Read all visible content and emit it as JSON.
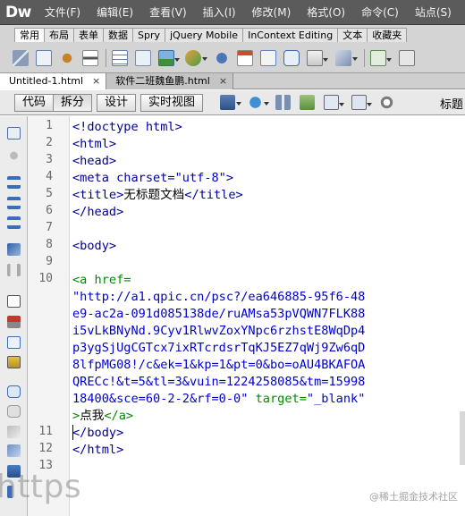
{
  "app": {
    "logo": "Dw"
  },
  "menu": [
    "文件(F)",
    "编辑(E)",
    "查看(V)",
    "插入(I)",
    "修改(M)",
    "格式(O)",
    "命令(C)",
    "站点(S)",
    "窗"
  ],
  "insert_tabs": [
    "常用",
    "布局",
    "表单",
    "数据",
    "Spry",
    "jQuery Mobile",
    "InContext Editing",
    "文本",
    "收藏夹"
  ],
  "insert_active_tab": "常用",
  "doc_tabs": [
    {
      "label": "Untitled-1.html",
      "close": "×",
      "active": true
    },
    {
      "label": "软件二班魏鱼鹏.html",
      "close": "×",
      "active": false
    }
  ],
  "view_buttons": [
    "代码",
    "拆分",
    "设计",
    "实时视图"
  ],
  "view_active": "拆分",
  "title_label": "标题",
  "line_numbers": [
    "1",
    "2",
    "3",
    "4",
    "5",
    "6",
    "7",
    "8",
    "9",
    "10",
    "11",
    "12",
    "13"
  ],
  "code": {
    "l1": "<!doctype html>",
    "l2": "<html>",
    "l3": "<head>",
    "l4a": "<meta charset=",
    "l4b": "\"utf-8\"",
    "l4c": ">",
    "l5a": "<title>",
    "l5b": "无标题文档",
    "l5c": "</title>",
    "l6": "</head>",
    "l8": "<body>",
    "l10a": "<a href=",
    "url": [
      "\"http://a1.qpic.cn/psc?/ea646885-95f6-48",
      "e9-ac2a-091d085138de/ruAMsa53pVQWN7FLK88",
      "i5vLkBNyNd.9Cyv1RlwvZoxYNpc6rzhstE8WqDp4",
      "p3ygSjUgCGTcx7ixRTcrdsrTqKJ5EZ7qWj9Zw6qD",
      "8lfpMG08!/c&ek=1&kp=1&pt=0&bo=oAU4BKAFOA",
      "QRECc!&t=5&tl=3&vuin=1224258085&tm=15998",
      "18400&sce=60-2-2&rf=0-0\""
    ],
    "target_attr": " target=",
    "target_val": "\"_blank\"",
    "l10_tail_a": ">",
    "l10_tail_b": "点我",
    "l10_tail_c": "</a>",
    "l11": "</body>",
    "l12": "</html>"
  },
  "overlay_word": "https",
  "watermark": "@稀土掘金技术社区"
}
